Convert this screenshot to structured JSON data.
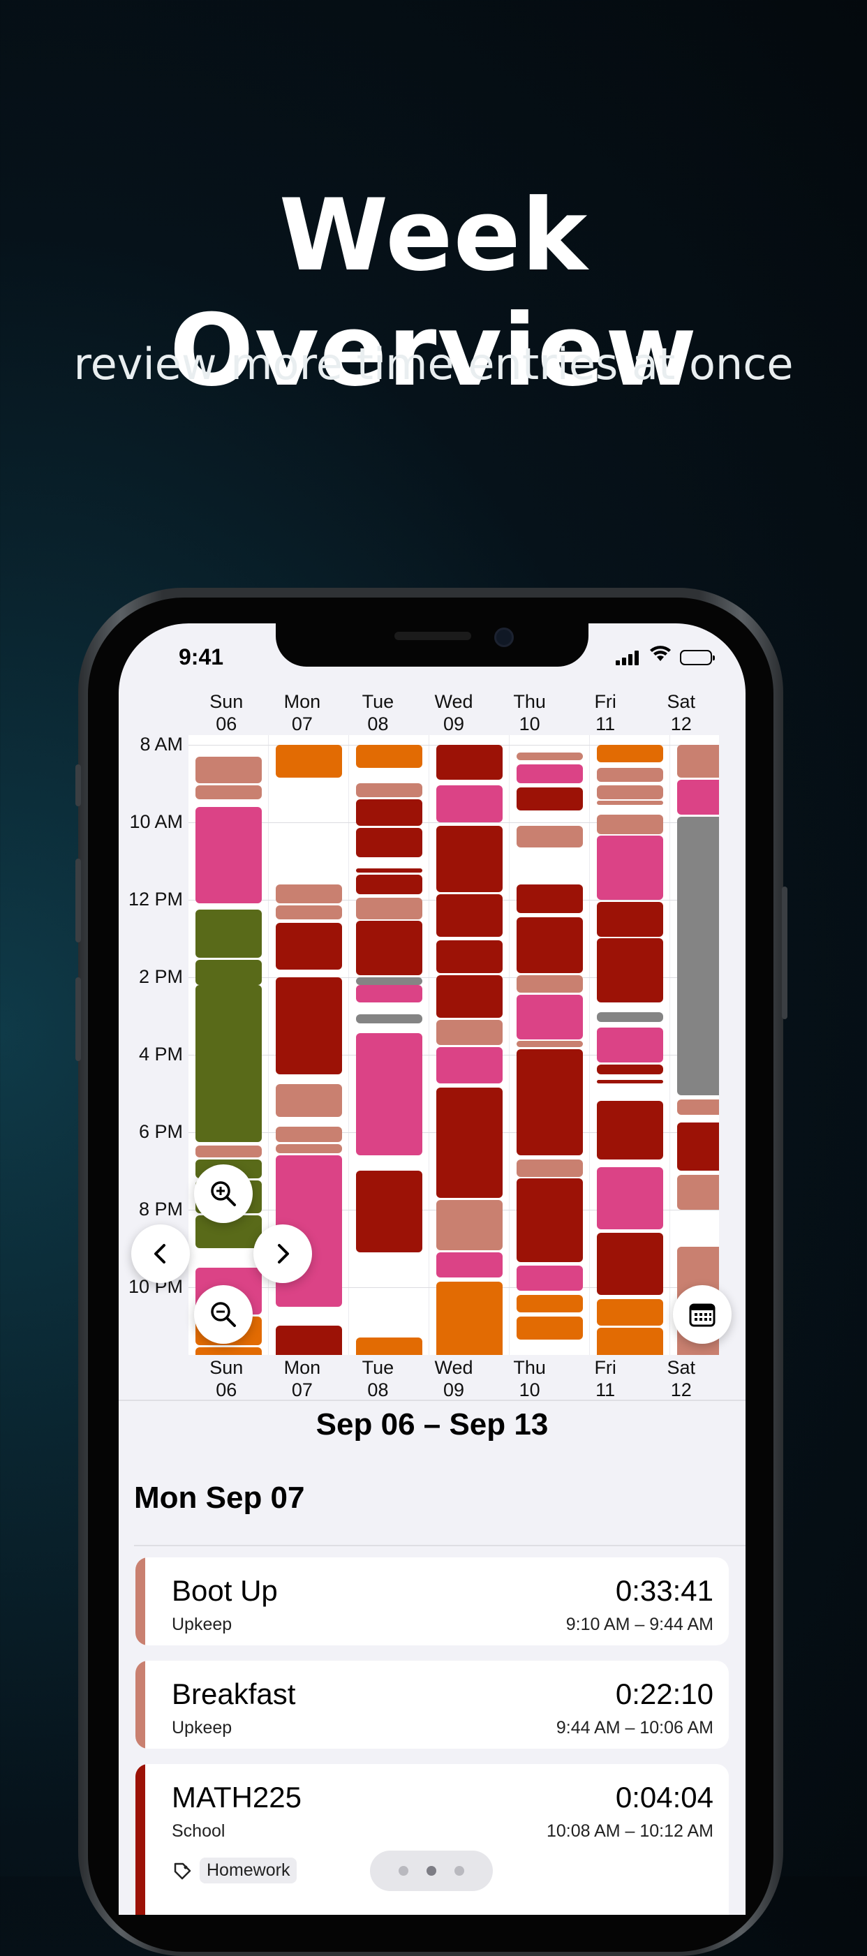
{
  "hero": {
    "title": "Week Overview",
    "subtitle": "review more time entries at once"
  },
  "status_bar": {
    "time": "9:41",
    "icons": [
      "signal-icon",
      "wifi-icon",
      "battery-icon"
    ]
  },
  "week": {
    "days": [
      {
        "name": "Sun",
        "date": "06"
      },
      {
        "name": "Mon",
        "date": "07"
      },
      {
        "name": "Tue",
        "date": "08"
      },
      {
        "name": "Wed",
        "date": "09"
      },
      {
        "name": "Thu",
        "date": "10"
      },
      {
        "name": "Fri",
        "date": "11"
      },
      {
        "name": "Sat",
        "date": "12"
      }
    ],
    "hour_labels": [
      "8 AM",
      "10 AM",
      "12 PM",
      "2 PM",
      "4 PM",
      "6 PM",
      "8 PM",
      "10 PM"
    ],
    "range_label": "Sep 06 – Sep 13",
    "colors": {
      "upkeep": "#c98070",
      "school": "#9c1206",
      "pink": "#db4386",
      "olive": "#596a19",
      "orange": "#e26b03",
      "gray": "#848484"
    },
    "blocks": [
      {
        "day": 0,
        "start": 8.3,
        "end": 9.0,
        "color": "upkeep"
      },
      {
        "day": 0,
        "start": 9.05,
        "end": 9.4,
        "color": "upkeep"
      },
      {
        "day": 0,
        "start": 9.6,
        "end": 12.1,
        "color": "pink"
      },
      {
        "day": 0,
        "start": 12.25,
        "end": 13.5,
        "color": "olive"
      },
      {
        "day": 0,
        "start": 13.55,
        "end": 14.2,
        "color": "olive"
      },
      {
        "day": 0,
        "start": 14.2,
        "end": 18.25,
        "color": "olive"
      },
      {
        "day": 0,
        "start": 18.35,
        "end": 18.65,
        "color": "upkeep"
      },
      {
        "day": 0,
        "start": 18.7,
        "end": 19.2,
        "color": "olive"
      },
      {
        "day": 0,
        "start": 19.25,
        "end": 20.1,
        "color": "olive"
      },
      {
        "day": 0,
        "start": 20.15,
        "end": 21.0,
        "color": "olive"
      },
      {
        "day": 0,
        "start": 21.5,
        "end": 22.7,
        "color": "pink"
      },
      {
        "day": 0,
        "start": 22.75,
        "end": 23.5,
        "color": "orange"
      },
      {
        "day": 0,
        "start": 23.55,
        "end": 23.9,
        "color": "orange"
      },
      {
        "day": 1,
        "start": 8.0,
        "end": 8.85,
        "color": "orange"
      },
      {
        "day": 1,
        "start": 11.6,
        "end": 12.1,
        "color": "upkeep"
      },
      {
        "day": 1,
        "start": 12.15,
        "end": 12.5,
        "color": "upkeep"
      },
      {
        "day": 1,
        "start": 12.6,
        "end": 13.8,
        "color": "school"
      },
      {
        "day": 1,
        "start": 14.0,
        "end": 16.5,
        "color": "school"
      },
      {
        "day": 1,
        "start": 16.75,
        "end": 17.6,
        "color": "upkeep"
      },
      {
        "day": 1,
        "start": 17.85,
        "end": 18.25,
        "color": "upkeep"
      },
      {
        "day": 1,
        "start": 18.3,
        "end": 18.55,
        "color": "upkeep"
      },
      {
        "day": 1,
        "start": 18.6,
        "end": 22.5,
        "color": "pink"
      },
      {
        "day": 1,
        "start": 23.0,
        "end": 23.9,
        "color": "school"
      },
      {
        "day": 2,
        "start": 8.0,
        "end": 8.6,
        "color": "orange"
      },
      {
        "day": 2,
        "start": 9.0,
        "end": 9.35,
        "color": "upkeep"
      },
      {
        "day": 2,
        "start": 9.4,
        "end": 10.1,
        "color": "school"
      },
      {
        "day": 2,
        "start": 10.15,
        "end": 10.9,
        "color": "school"
      },
      {
        "day": 2,
        "start": 11.2,
        "end": 11.3,
        "color": "school"
      },
      {
        "day": 2,
        "start": 11.35,
        "end": 11.85,
        "color": "school"
      },
      {
        "day": 2,
        "start": 11.95,
        "end": 12.5,
        "color": "upkeep"
      },
      {
        "day": 2,
        "start": 12.55,
        "end": 13.95,
        "color": "school"
      },
      {
        "day": 2,
        "start": 14.0,
        "end": 14.2,
        "color": "gray"
      },
      {
        "day": 2,
        "start": 14.2,
        "end": 14.65,
        "color": "pink"
      },
      {
        "day": 2,
        "start": 14.95,
        "end": 15.2,
        "color": "gray"
      },
      {
        "day": 2,
        "start": 15.45,
        "end": 18.6,
        "color": "pink"
      },
      {
        "day": 2,
        "start": 19.0,
        "end": 21.1,
        "color": "school"
      },
      {
        "day": 2,
        "start": 23.3,
        "end": 23.9,
        "color": "orange"
      },
      {
        "day": 3,
        "start": 8.0,
        "end": 8.9,
        "color": "school"
      },
      {
        "day": 3,
        "start": 9.05,
        "end": 10.0,
        "color": "pink"
      },
      {
        "day": 3,
        "start": 10.1,
        "end": 11.8,
        "color": "school"
      },
      {
        "day": 3,
        "start": 11.85,
        "end": 12.95,
        "color": "school"
      },
      {
        "day": 3,
        "start": 13.05,
        "end": 13.9,
        "color": "school"
      },
      {
        "day": 3,
        "start": 13.95,
        "end": 15.05,
        "color": "school"
      },
      {
        "day": 3,
        "start": 15.1,
        "end": 15.75,
        "color": "upkeep"
      },
      {
        "day": 3,
        "start": 15.8,
        "end": 16.75,
        "color": "pink"
      },
      {
        "day": 3,
        "start": 16.85,
        "end": 19.7,
        "color": "school"
      },
      {
        "day": 3,
        "start": 19.75,
        "end": 21.05,
        "color": "upkeep"
      },
      {
        "day": 3,
        "start": 21.1,
        "end": 21.75,
        "color": "pink"
      },
      {
        "day": 3,
        "start": 21.85,
        "end": 23.9,
        "color": "orange"
      },
      {
        "day": 4,
        "start": 8.2,
        "end": 8.4,
        "color": "upkeep"
      },
      {
        "day": 4,
        "start": 8.5,
        "end": 9.0,
        "color": "pink"
      },
      {
        "day": 4,
        "start": 9.1,
        "end": 9.7,
        "color": "school"
      },
      {
        "day": 4,
        "start": 10.1,
        "end": 10.65,
        "color": "upkeep"
      },
      {
        "day": 4,
        "start": 11.6,
        "end": 12.35,
        "color": "school"
      },
      {
        "day": 4,
        "start": 12.45,
        "end": 13.9,
        "color": "school"
      },
      {
        "day": 4,
        "start": 13.95,
        "end": 14.4,
        "color": "upkeep"
      },
      {
        "day": 4,
        "start": 14.45,
        "end": 15.6,
        "color": "pink"
      },
      {
        "day": 4,
        "start": 15.65,
        "end": 15.8,
        "color": "upkeep"
      },
      {
        "day": 4,
        "start": 15.85,
        "end": 18.6,
        "color": "school"
      },
      {
        "day": 4,
        "start": 18.7,
        "end": 19.15,
        "color": "upkeep"
      },
      {
        "day": 4,
        "start": 19.2,
        "end": 21.35,
        "color": "school"
      },
      {
        "day": 4,
        "start": 21.45,
        "end": 22.1,
        "color": "pink"
      },
      {
        "day": 4,
        "start": 22.2,
        "end": 22.65,
        "color": "orange"
      },
      {
        "day": 4,
        "start": 22.75,
        "end": 23.35,
        "color": "orange"
      },
      {
        "day": 5,
        "start": 8.0,
        "end": 8.45,
        "color": "orange"
      },
      {
        "day": 5,
        "start": 8.6,
        "end": 8.95,
        "color": "upkeep"
      },
      {
        "day": 5,
        "start": 9.05,
        "end": 9.4,
        "color": "upkeep"
      },
      {
        "day": 5,
        "start": 9.45,
        "end": 9.55,
        "color": "upkeep"
      },
      {
        "day": 5,
        "start": 9.8,
        "end": 10.3,
        "color": "upkeep"
      },
      {
        "day": 5,
        "start": 10.35,
        "end": 12.0,
        "color": "pink"
      },
      {
        "day": 5,
        "start": 12.05,
        "end": 12.95,
        "color": "school"
      },
      {
        "day": 5,
        "start": 13.0,
        "end": 14.65,
        "color": "school"
      },
      {
        "day": 5,
        "start": 14.9,
        "end": 15.15,
        "color": "gray"
      },
      {
        "day": 5,
        "start": 15.3,
        "end": 16.2,
        "color": "pink"
      },
      {
        "day": 5,
        "start": 16.25,
        "end": 16.5,
        "color": "school"
      },
      {
        "day": 5,
        "start": 16.65,
        "end": 16.75,
        "color": "school"
      },
      {
        "day": 5,
        "start": 17.2,
        "end": 18.7,
        "color": "school"
      },
      {
        "day": 5,
        "start": 18.9,
        "end": 20.5,
        "color": "pink"
      },
      {
        "day": 5,
        "start": 20.6,
        "end": 22.2,
        "color": "school"
      },
      {
        "day": 5,
        "start": 22.3,
        "end": 23.0,
        "color": "orange"
      },
      {
        "day": 5,
        "start": 23.05,
        "end": 23.9,
        "color": "orange"
      },
      {
        "day": 6,
        "start": 8.0,
        "end": 8.85,
        "color": "upkeep"
      },
      {
        "day": 6,
        "start": 8.9,
        "end": 9.8,
        "color": "pink"
      },
      {
        "day": 6,
        "start": 9.85,
        "end": 17.05,
        "color": "gray"
      },
      {
        "day": 6,
        "start": 17.15,
        "end": 17.55,
        "color": "upkeep"
      },
      {
        "day": 6,
        "start": 17.75,
        "end": 19.0,
        "color": "school"
      },
      {
        "day": 6,
        "start": 19.1,
        "end": 20.0,
        "color": "upkeep"
      },
      {
        "day": 6,
        "start": 20.95,
        "end": 23.9,
        "color": "upkeep"
      }
    ]
  },
  "list": {
    "day_title": "Mon Sep 07",
    "entries": [
      {
        "title": "Boot Up",
        "category": "Upkeep",
        "duration": "0:33:41",
        "range": "9:10 AM – 9:44 AM",
        "color": "#c98070"
      },
      {
        "title": "Breakfast",
        "category": "Upkeep",
        "duration": "0:22:10",
        "range": "9:44 AM – 10:06 AM",
        "color": "#c98070"
      },
      {
        "title": "MATH225",
        "category": "School",
        "duration": "0:04:04",
        "range": "10:08 AM – 10:12 AM",
        "color": "#9c1206",
        "tag": "Homework"
      }
    ]
  },
  "icons": {
    "zoom_in": "zoom-in-icon",
    "zoom_out": "zoom-out-icon",
    "prev": "chevron-left-icon",
    "next": "chevron-right-icon",
    "calendar": "calendar-icon",
    "tag": "tag-icon"
  }
}
